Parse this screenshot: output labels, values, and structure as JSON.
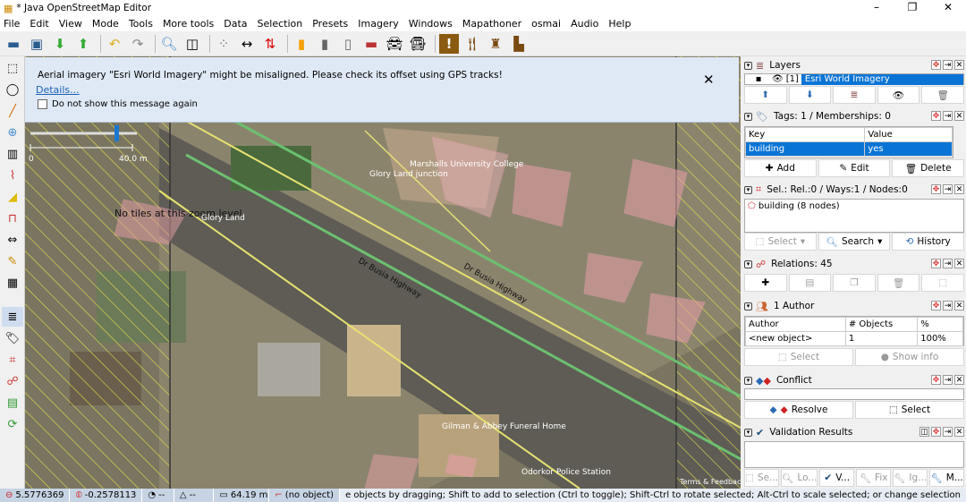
{
  "window": {
    "title": "* Java OpenStreetMap Editor",
    "minimize": "–",
    "maximize": "❐",
    "close": "✕"
  },
  "menu": [
    "File",
    "Edit",
    "View",
    "Mode",
    "Tools",
    "More tools",
    "Data",
    "Selection",
    "Presets",
    "Imagery",
    "Windows",
    "Mapathoner",
    "osmai",
    "Audio",
    "Help"
  ],
  "toolbar_icons": [
    "open-icon",
    "save-icon",
    "download-icon",
    "upload-icon",
    "undo-icon",
    "redo-icon",
    "zoom-icon",
    "preferences-icon",
    "combine-way-icon",
    "split-way-icon",
    "reverse-icon",
    "road-yellow-icon",
    "road-grey-icon",
    "road-service-icon",
    "wall-icon",
    "car-icon",
    "bus-icon",
    "hazard-icon",
    "restaurant-icon",
    "castle-icon",
    "factory-icon"
  ],
  "notification": {
    "message": "Aerial imagery \"Esri World Imagery\" might be misaligned. Please check its offset using GPS tracks!",
    "details_link": "Details...",
    "checkbox_label": "Do not show this message again",
    "close": "✕"
  },
  "map": {
    "scale_start": "0",
    "scale_end": "40.0 m",
    "no_tiles": "No tiles at this zoom level",
    "labels": [
      "Marshalls University College",
      "Glory Land junction",
      "Glory Land",
      "Dr Busia Highway",
      "Dr Busia Highway",
      "Gilman & Abbey Funeral Home",
      "Odorkor Police Station",
      "Terms & Feedback"
    ]
  },
  "layers": {
    "title": "Layers",
    "row": {
      "index": "[1]",
      "name": "Esri World Imagery"
    }
  },
  "tags": {
    "title": "Tags: 1 / Memberships: 0",
    "headers": [
      "Key",
      "Value"
    ],
    "rows": [
      [
        "building",
        "yes"
      ]
    ],
    "add": "Add",
    "edit": "Edit",
    "delete": "Delete"
  },
  "selection": {
    "title": "Sel.: Rel.:0 / Ways:1 / Nodes:0",
    "items": [
      "building (8 nodes)"
    ],
    "select": "Select",
    "search": "Search",
    "history": "History"
  },
  "relations": {
    "title": "Relations: 45"
  },
  "author": {
    "title": "1 Author",
    "headers": [
      "Author",
      "# Objects",
      "%"
    ],
    "rows": [
      [
        "<new object>",
        "1",
        "100%"
      ]
    ],
    "select": "Select",
    "show_info": "Show info"
  },
  "conflict": {
    "title": "Conflict",
    "resolve": "Resolve",
    "select": "Select"
  },
  "validation": {
    "title": "Validation Results",
    "tabs": [
      "Se...",
      "Lo...",
      "V...",
      "Fix",
      "Ig...",
      "M..."
    ]
  },
  "status": {
    "lat": "5.5776369",
    "lon": "-0.2578113",
    "heading": "--",
    "angle": "--",
    "distance": "64.19 m",
    "object": "(no object)",
    "help": "e objects by dragging; Shift to add to selection (Ctrl to toggle); Shift-Ctrl to rotate selected; Alt-Ctrl to scale selected; or change selection"
  }
}
